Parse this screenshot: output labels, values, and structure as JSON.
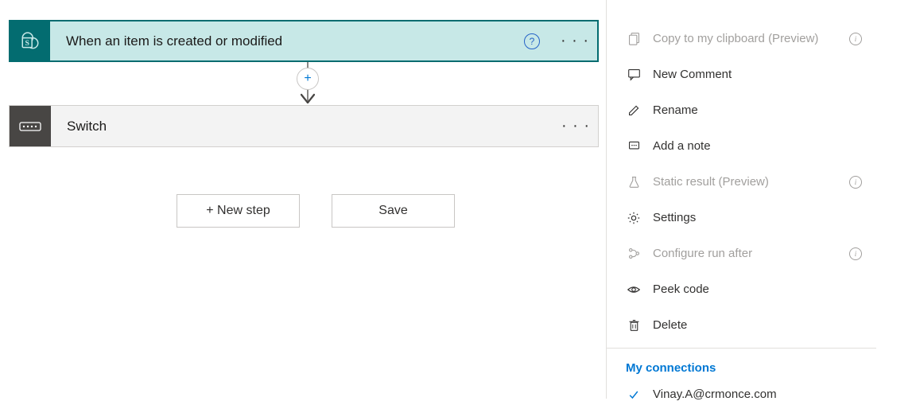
{
  "trigger": {
    "title": "When an item is created or modified"
  },
  "switch": {
    "title": "Switch"
  },
  "buttons": {
    "new_step": "+ New step",
    "save": "Save"
  },
  "menu": {
    "copy": "Copy to my clipboard (Preview)",
    "new_comment": "New Comment",
    "rename": "Rename",
    "add_note": "Add a note",
    "static_result": "Static result (Preview)",
    "settings": "Settings",
    "configure_run_after": "Configure run after",
    "peek_code": "Peek code",
    "delete": "Delete"
  },
  "connections": {
    "header": "My connections",
    "items": [
      "Vinay.A@crmonce.com"
    ]
  }
}
